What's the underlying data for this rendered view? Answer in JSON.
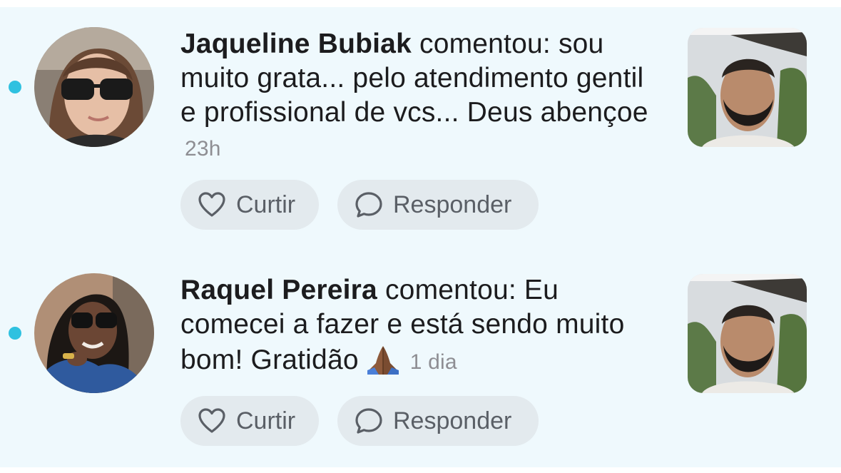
{
  "notifications": [
    {
      "author": "Jaqueline Bubiak",
      "message": " comentou: sou muito grata... pelo atendimento gentil e profissional de vcs... Deus abençoe",
      "emoji": "",
      "time": "23h",
      "like_label": "Curtir",
      "reply_label": "Responder"
    },
    {
      "author": "Raquel Pereira",
      "message": " comentou: Eu comecei a fazer e está sendo muito bom! Gratidão",
      "emoji": "folded-hands-icon",
      "time": "1 dia",
      "like_label": "Curtir",
      "reply_label": "Responder"
    }
  ],
  "colors": {
    "background": "#eff9fd",
    "unread_dot": "#2fc1e0",
    "pill": "#e3eaee",
    "muted_text": "#8e8e93"
  },
  "icons": {
    "like": "heart-outline-icon",
    "reply": "speech-bubble-icon"
  }
}
